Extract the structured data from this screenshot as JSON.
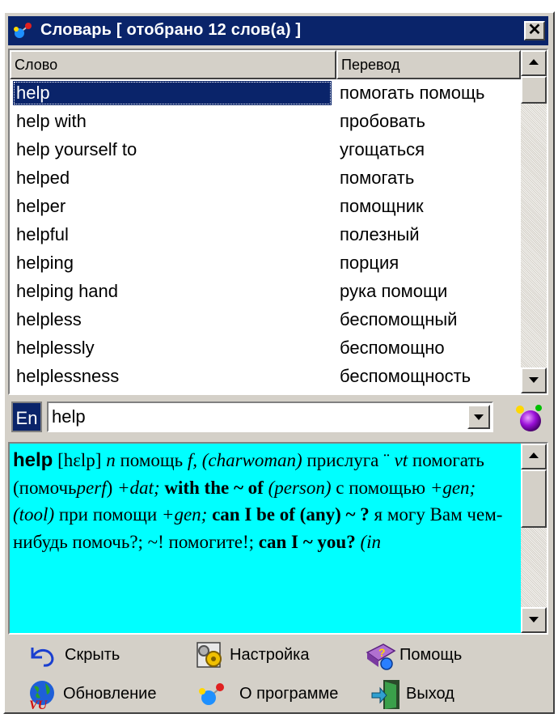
{
  "window": {
    "title": "Словарь [ отобрано 12 слов(а) ]",
    "close_glyph": "✕",
    "accent_color": "#0a246a"
  },
  "list": {
    "headers": {
      "word": "Слово",
      "translation": "Перевод"
    },
    "selected_index": 0,
    "rows": [
      {
        "word": "help",
        "translation": "помогать помощь"
      },
      {
        "word": "help with",
        "translation": "пробовать"
      },
      {
        "word": "help yourself to",
        "translation": "угощаться"
      },
      {
        "word": "helped",
        "translation": "помогать"
      },
      {
        "word": "helper",
        "translation": "помощник"
      },
      {
        "word": "helpful",
        "translation": "полезный"
      },
      {
        "word": "helping",
        "translation": "порция"
      },
      {
        "word": "helping hand",
        "translation": "рука помощи"
      },
      {
        "word": "helpless",
        "translation": "беспомощный"
      },
      {
        "word": "helplessly",
        "translation": "беспомощно"
      },
      {
        "word": "helplessness",
        "translation": "беспомощность"
      }
    ]
  },
  "search": {
    "language": "En",
    "value": "help"
  },
  "description": {
    "background": "#00ffff",
    "headword": "help",
    "transcription": "[hɛlp]",
    "pos_n": "n",
    "t1": "помощь",
    "g1": "f,",
    "c1": "(charwoman)",
    "t2": "прислуга",
    "sep": "¨",
    "pos_vt": "vt",
    "t3": "помогать (помочь",
    "perf": "perf",
    "t4": ")",
    "dat": "+dat;",
    "phr1": "with the ~ of",
    "c2": "(person)",
    "t5": "с помощью",
    "gen1": "+gen;",
    "c3": "(tool)",
    "t6": "при помощи",
    "gen2": "+gen;",
    "phr2": "can I be of (any) ~ ?",
    "t7": "я могу Вам чем-нибудь помочь?; ~! помогите!;",
    "phr3": "can I ~ you?",
    "c4": "(in"
  },
  "toolbar": {
    "buttons": [
      {
        "label": "Скрыть",
        "icon": "hide-arrow-icon"
      },
      {
        "label": "Настройка",
        "icon": "settings-gears-icon"
      },
      {
        "label": "Помощь",
        "icon": "help-book-icon"
      },
      {
        "label": "Обновление",
        "icon": "update-globe-icon"
      },
      {
        "label": "О программе",
        "icon": "about-molecule-icon"
      },
      {
        "label": "Выход",
        "icon": "exit-door-icon"
      }
    ]
  }
}
